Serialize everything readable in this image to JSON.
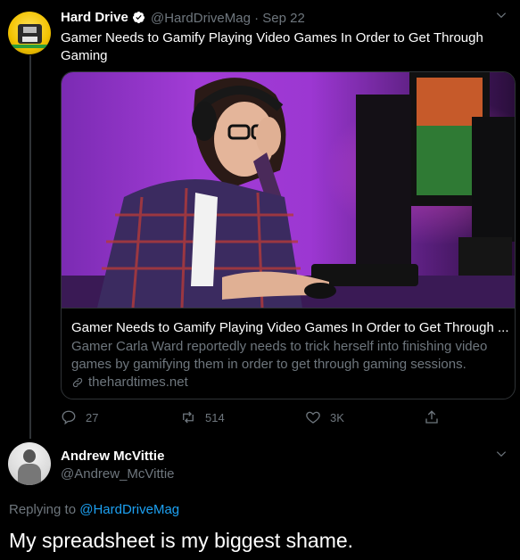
{
  "tweet1": {
    "name": "Hard Drive",
    "handle_date": "@HardDriveMag · Sep 22",
    "text": "Gamer Needs to Gamify Playing Video Games In Order to Get Through Gaming",
    "card": {
      "title": "Gamer Needs to Gamify Playing Video Games In Order to Get Through ...",
      "description": "Gamer Carla Ward reportedly needs to trick herself into finishing video games by gamifying them in order to get through gaming sessions.",
      "domain": "thehardtimes.net"
    },
    "actions": {
      "replies": "27",
      "retweets": "514",
      "likes": "3K"
    }
  },
  "tweet2": {
    "name": "Andrew McVittie",
    "handle": "@Andrew_McVittie",
    "replying_label": "Replying to ",
    "replying_to": "@HardDriveMag",
    "text": "My spreadsheet is my biggest shame."
  },
  "icons": [
    "verified-badge-icon",
    "chevron-down-icon",
    "link-icon",
    "reply-icon",
    "retweet-icon",
    "like-icon",
    "share-icon"
  ],
  "colors": {
    "background": "#000000",
    "text": "#ffffff",
    "secondary": "#6e767d",
    "accent": "#1da1f2",
    "border": "#2f3336"
  }
}
